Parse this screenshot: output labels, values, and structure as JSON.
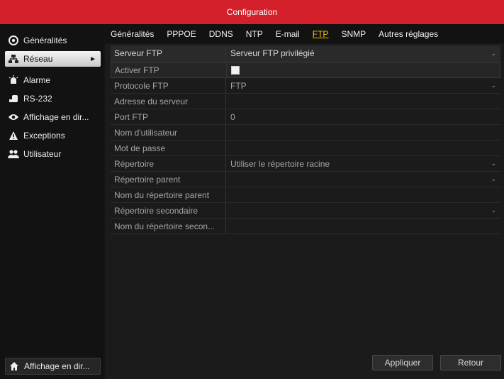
{
  "window": {
    "title": "Configuration"
  },
  "sidebar": {
    "items": [
      {
        "label": "Généralités",
        "icon": "gear-icon"
      },
      {
        "label": "Réseau",
        "icon": "network-icon",
        "active": true
      },
      {
        "label": "Alarme",
        "icon": "alarm-icon"
      },
      {
        "label": "RS-232",
        "icon": "serial-port-icon"
      },
      {
        "label": "Affichage en dir...",
        "icon": "eye-icon"
      },
      {
        "label": "Exceptions",
        "icon": "warning-icon"
      },
      {
        "label": "Utilisateur",
        "icon": "users-icon"
      }
    ],
    "bottom": {
      "label": "Affichage en dir...",
      "icon": "home-icon"
    }
  },
  "tabs": [
    "Généralités",
    "PPPOE",
    "DDNS",
    "NTP",
    "E-mail",
    "FTP",
    "SNMP",
    "Autres réglages"
  ],
  "active_tab": "FTP",
  "rows": [
    {
      "label": "Serveur FTP",
      "value": "Serveur FTP privilégié",
      "dropdown": true,
      "header": true
    },
    {
      "label": "Activer FTP",
      "value": "",
      "checkbox": true,
      "checked": false
    },
    {
      "label": "Protocole FTP",
      "value": "FTP",
      "dropdown": true
    },
    {
      "label": "Adresse du serveur",
      "value": ""
    },
    {
      "label": "Port FTP",
      "value": "0"
    },
    {
      "label": "Nom d'utilisateur",
      "value": ""
    },
    {
      "label": "Mot de passe",
      "value": ""
    },
    {
      "label": "Répertoire",
      "value": "Utiliser le répertoire racine",
      "dropdown": true
    },
    {
      "label": "Répertoire parent",
      "value": "",
      "dropdown": true
    },
    {
      "label": "Nom du répertoire parent",
      "value": ""
    },
    {
      "label": "Répertoire secondaire",
      "value": "",
      "dropdown": true
    },
    {
      "label": "Nom du répertoire secon...",
      "value": ""
    }
  ],
  "buttons": {
    "apply": "Appliquer",
    "back": "Retour"
  },
  "colors": {
    "titlebar": "#d4202a",
    "active_tab": "#f7c600"
  }
}
